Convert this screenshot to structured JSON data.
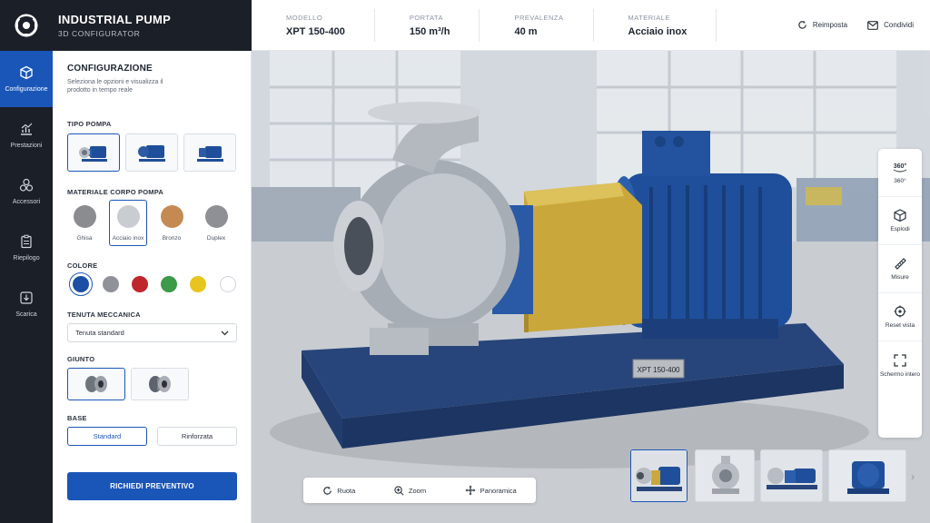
{
  "brand": {
    "title": "INDUSTRIAL PUMP",
    "subtitle": "3D CONFIGURATOR",
    "logo_icon": "gear-pump-logo"
  },
  "specs": [
    {
      "label": "MODELLO",
      "value": "XPT 150-400"
    },
    {
      "label": "PORTATA",
      "value": "150 m³/h"
    },
    {
      "label": "PREVALENZA",
      "value": "40 m"
    },
    {
      "label": "MATERIALE",
      "value": "Acciaio inox"
    }
  ],
  "top_actions": {
    "reset": "Reimposta",
    "share": "Condividi"
  },
  "rail": [
    {
      "label": "Configurazione",
      "icon": "cube-icon",
      "active": true
    },
    {
      "label": "Prestazioni",
      "icon": "chart-icon",
      "active": false
    },
    {
      "label": "Accessori",
      "icon": "components-icon",
      "active": false
    },
    {
      "label": "Riepilogo",
      "icon": "clipboard-icon",
      "active": false
    },
    {
      "label": "Scarica",
      "icon": "download-icon",
      "active": false
    }
  ],
  "panel": {
    "title": "CONFIGURAZIONE",
    "description": "Seleziona le opzioni e visualizza il prodotto in tempo reale",
    "pump_type": {
      "label": "TIPO POMPA",
      "selected_index": 0
    },
    "body_material": {
      "label": "MATERIALE CORPO POMPA",
      "options": [
        {
          "label": "Ghisa",
          "color": "#8a8c90"
        },
        {
          "label": "Acciaio inox",
          "color": "#c9ccd0"
        },
        {
          "label": "Bronzo",
          "color": "#c48a52"
        },
        {
          "label": "Duplex",
          "color": "#8e9095"
        }
      ],
      "selected_index": 1
    },
    "color": {
      "label": "COLORE",
      "options": [
        "#1a4fa3",
        "#8f9297",
        "#c0272d",
        "#3c9a48",
        "#e8c51c",
        "#ffffff"
      ],
      "selected_index": 0
    },
    "seal": {
      "label": "TENUTA MECCANICA",
      "value": "Tenuta standard"
    },
    "coupling": {
      "label": "GIUNTO",
      "selected_index": 0
    },
    "base": {
      "label": "BASE",
      "options": [
        "Standard",
        "Rinforzata"
      ],
      "selected_index": 0
    },
    "cta": "RICHIEDI PREVENTIVO"
  },
  "viewport": {
    "nameplate": "XPT 150-400",
    "tools": [
      {
        "label": "360°",
        "icon": "rotate-360-icon"
      },
      {
        "label": "Esplodi",
        "icon": "explode-cube-icon"
      },
      {
        "label": "Misure",
        "icon": "ruler-icon"
      },
      {
        "label": "Reset vista",
        "icon": "target-icon"
      },
      {
        "label": "Schermo intero",
        "icon": "fullscreen-icon"
      }
    ],
    "view_controls": [
      {
        "label": "Ruota",
        "icon": "rotate-icon"
      },
      {
        "label": "Zoom",
        "icon": "zoom-icon"
      },
      {
        "label": "Panoramica",
        "icon": "pan-icon"
      }
    ],
    "gallery_selected_index": 0
  }
}
